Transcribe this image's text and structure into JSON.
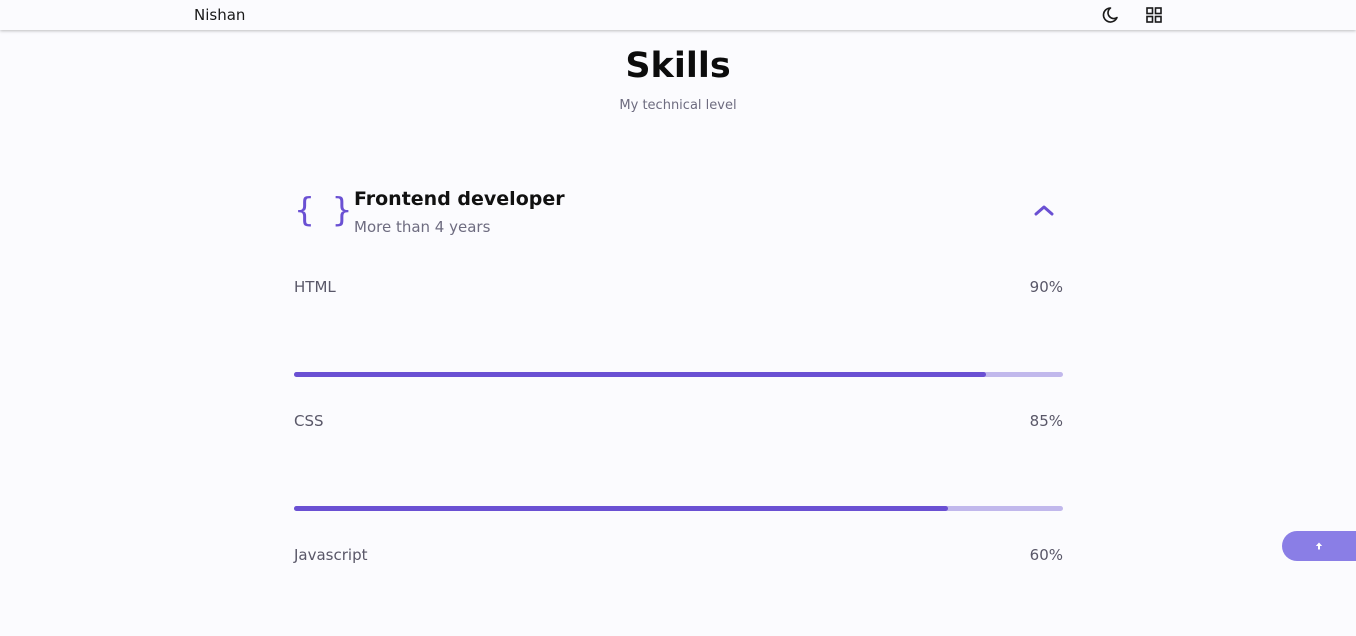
{
  "header": {
    "logo": "Nishan",
    "theme_icon": "moon-icon",
    "menu_icon": "grid-icon"
  },
  "section": {
    "title": "Skills",
    "subtitle": "My technical level"
  },
  "skills_group": {
    "icon": "braces-icon",
    "icon_glyph": "{ }",
    "title": "Frontend developer",
    "subtitle": "More than 4 years",
    "toggle_icon": "chevron-up-icon",
    "items": [
      {
        "name": "HTML",
        "percent_label": "90%",
        "value": 90
      },
      {
        "name": "CSS",
        "percent_label": "85%",
        "value": 85
      },
      {
        "name": "Javascript",
        "percent_label": "60%",
        "value": 60
      }
    ]
  },
  "scrollup": {
    "icon": "arrow-up-icon"
  },
  "colors": {
    "accent": "#6a50d3",
    "accent_light": "#c1b8ec",
    "scrollup_bg": "#8a7ee6",
    "background": "#fbfbfe"
  }
}
